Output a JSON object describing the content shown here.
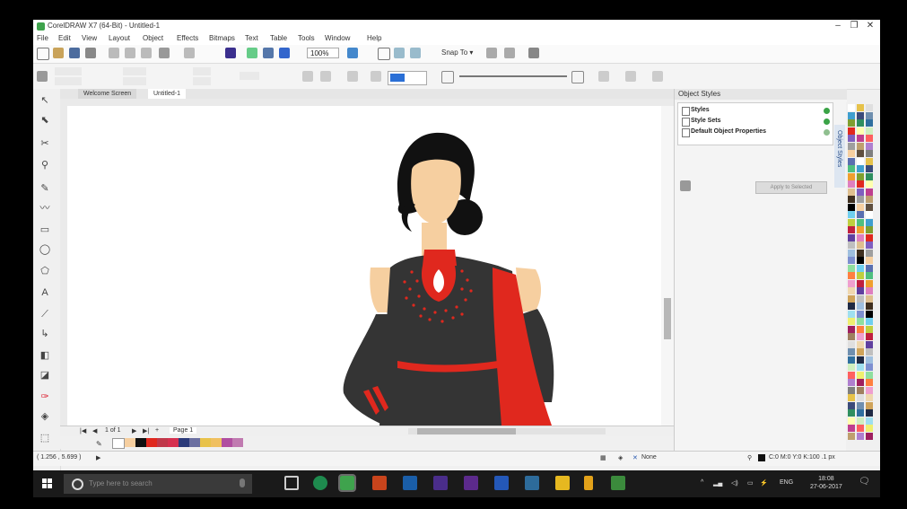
{
  "window": {
    "title": "CorelDRAW X7 (64-Bit) - Untitled-1",
    "minimize": "–",
    "restore": "❐",
    "close": "✕"
  },
  "menu": [
    "File",
    "Edit",
    "View",
    "Layout",
    "Object",
    "Effects",
    "Bitmaps",
    "Text",
    "Table",
    "Tools",
    "Window",
    "Help"
  ],
  "toolbar": {
    "zoom_value": "100%",
    "snap_to": "Snap To ▾"
  },
  "document_tabs": [
    "Welcome Screen",
    "Untitled-1"
  ],
  "page_nav": {
    "page_count": "1 of 1",
    "page_label": "Page 1"
  },
  "object_styles": {
    "title": "Object Styles",
    "items": [
      "Styles",
      "Style Sets",
      "Default Object Properties"
    ],
    "apply_button": "Apply to Selected",
    "vertical_tab": "Object Styles"
  },
  "status": {
    "coords": "( 1.256 , 5.699 )",
    "fill_none": "None",
    "color_info": "C:0 M:0 Y:0 K:100  .1 px"
  },
  "taskbar": {
    "search_placeholder": "Type here to search",
    "lang": "ENG",
    "time": "18:08",
    "date": "27-06-2017"
  },
  "colors": {
    "accent_red": "#e0281e",
    "dress_dark": "#343434",
    "skin": "#f6cfa0",
    "hair": "#111111"
  }
}
